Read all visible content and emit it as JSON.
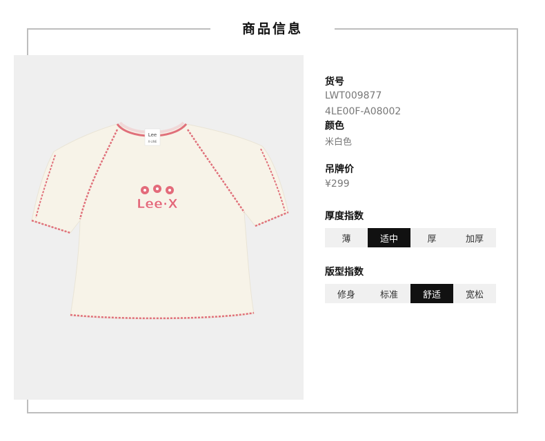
{
  "section_title": "商品信息",
  "product": {
    "item_no_label": "货号",
    "item_no_1": "LWT009877",
    "item_no_2": "4LE00F-A08002",
    "color_label": "颜色",
    "color_value": "米白色",
    "price_label": "吊牌价",
    "price_value": "¥299"
  },
  "thickness": {
    "label": "厚度指数",
    "options": [
      "薄",
      "适中",
      "厚",
      "加厚"
    ],
    "selected": 1
  },
  "fit": {
    "label": "版型指数",
    "options": [
      "修身",
      "标准",
      "舒适",
      "宽松"
    ],
    "selected": 2
  },
  "tshirt_graphic": {
    "brand_print": "Lee·X",
    "neck_label_1": "Lee",
    "neck_label_2": "X-LINE",
    "shirt_color": "#f7f3e8",
    "stitch_color": "#e0707a"
  }
}
